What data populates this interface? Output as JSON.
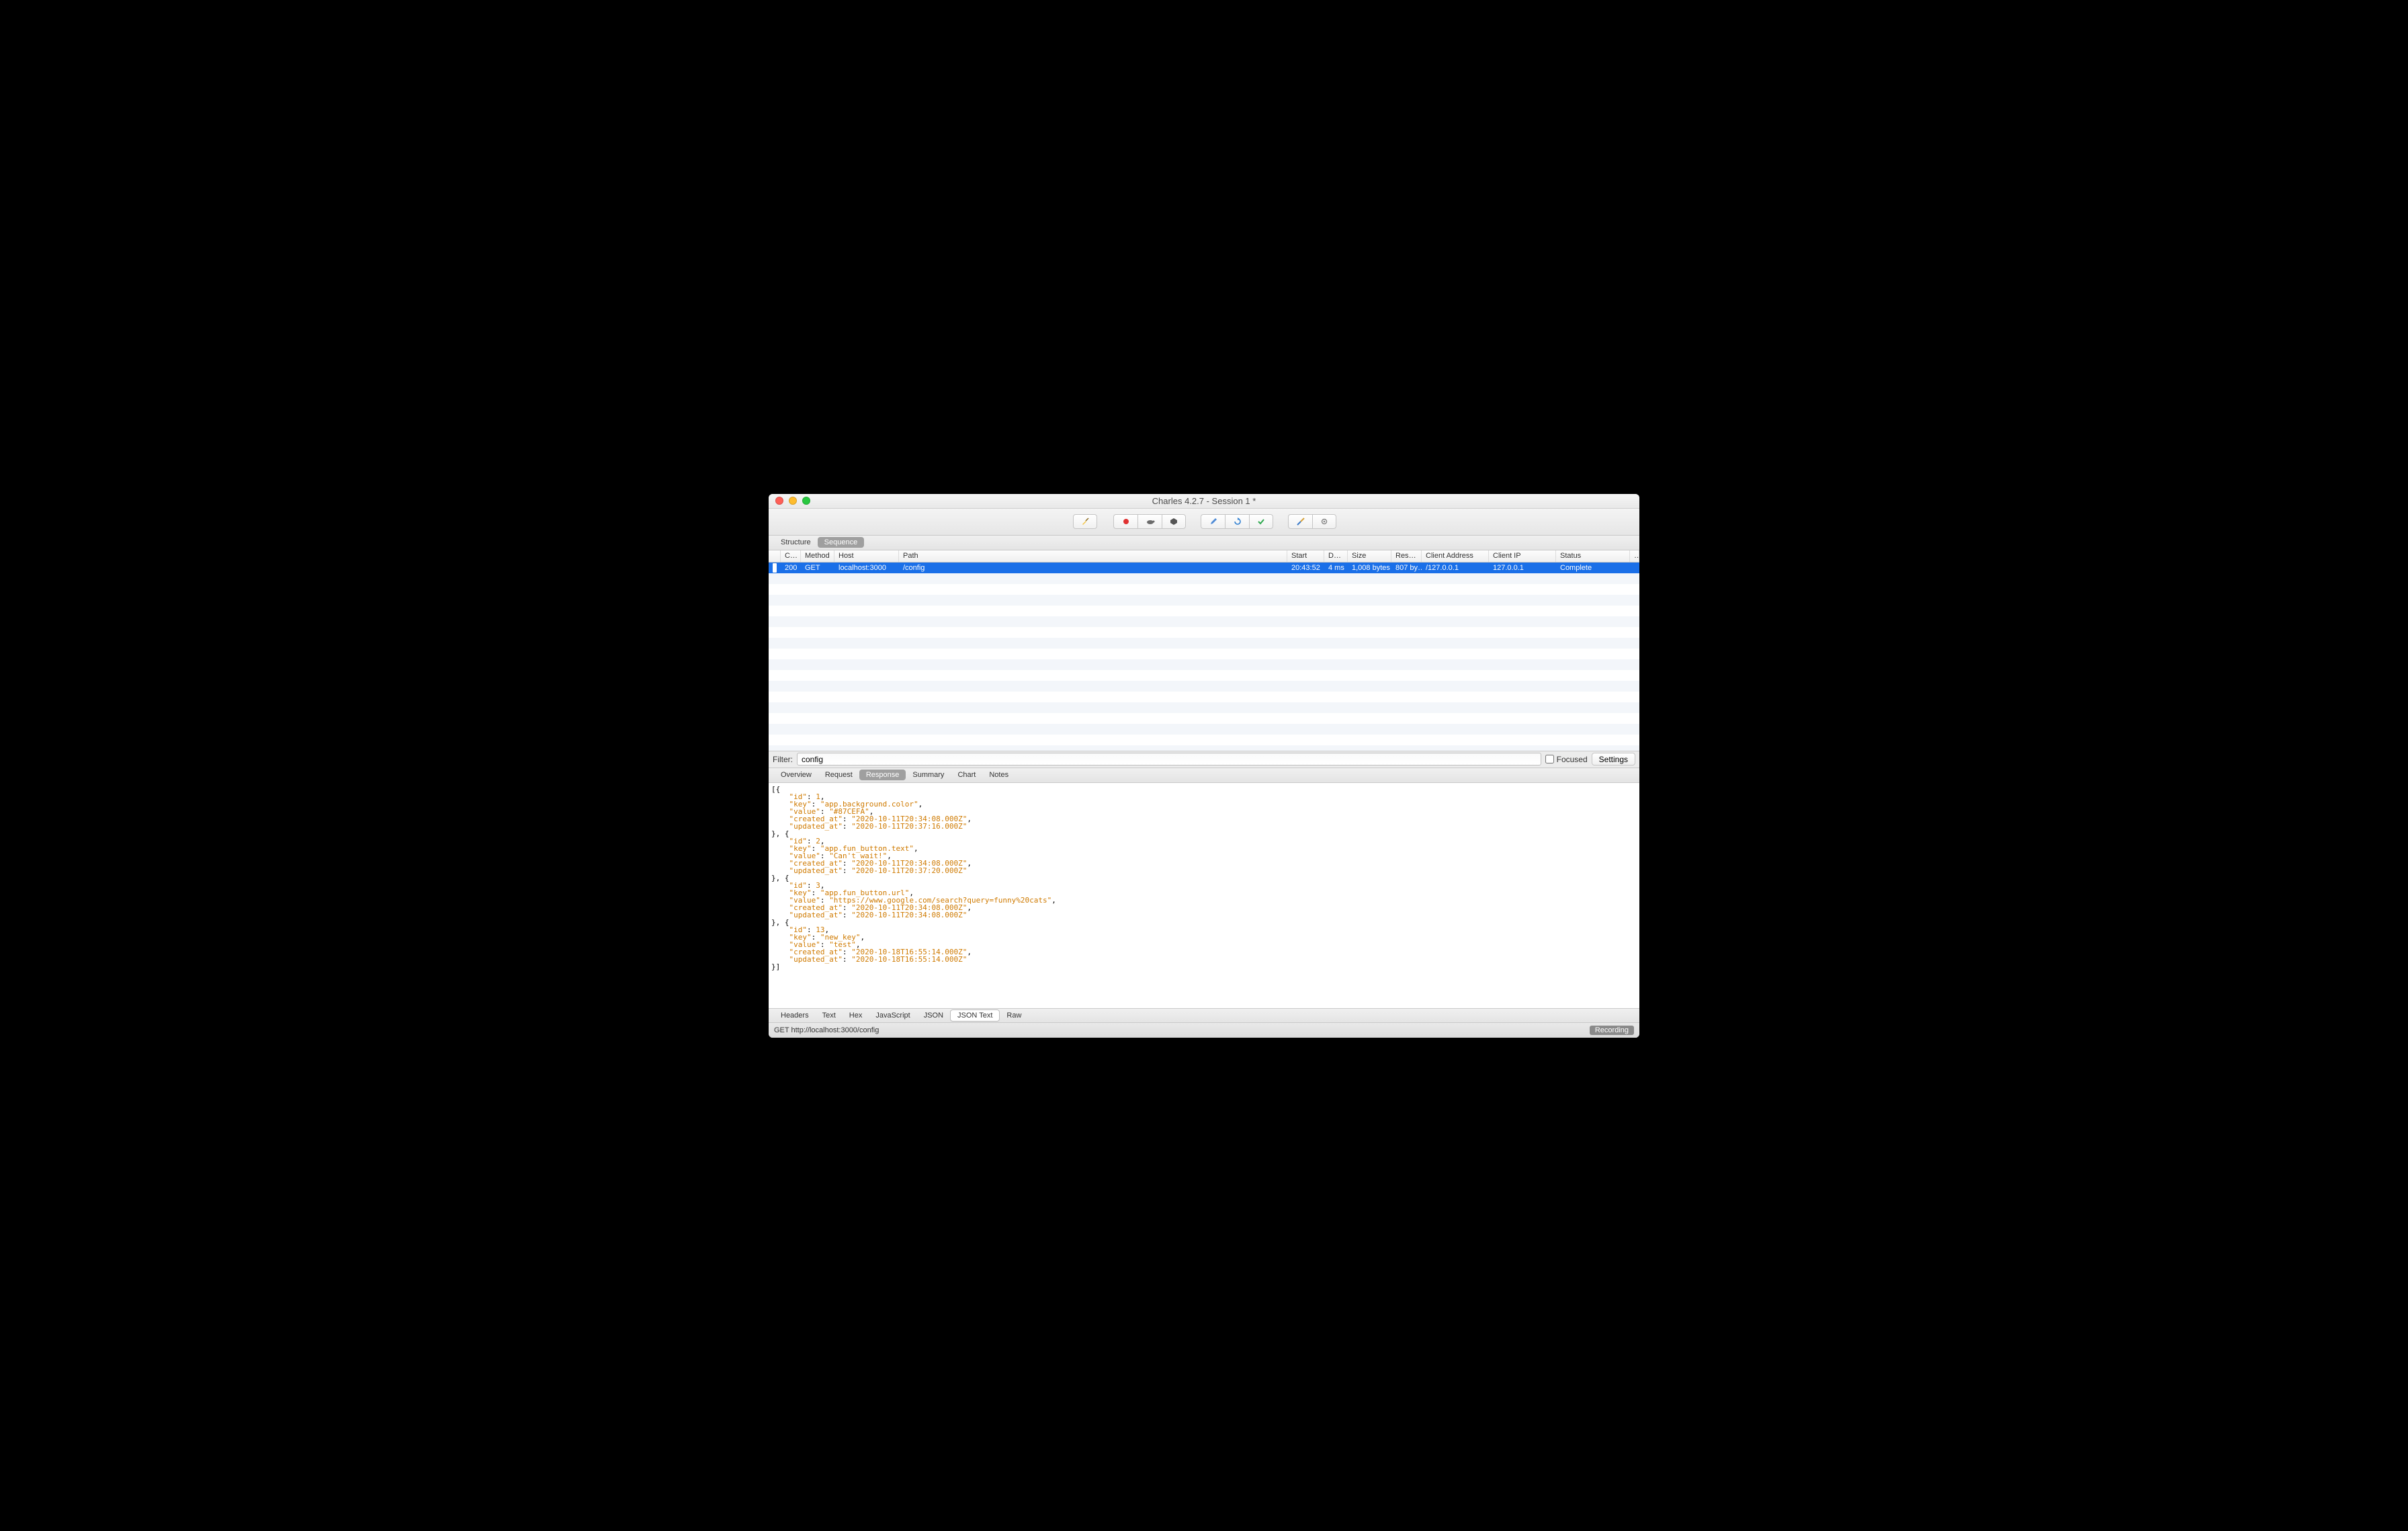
{
  "window": {
    "title": "Charles 4.2.7 - Session 1 *"
  },
  "toolbar_icons": [
    "broom",
    "record",
    "turtle-dark",
    "turtle-darker",
    "pencil",
    "refresh",
    "check",
    "wrench",
    "gear"
  ],
  "view_tabs": [
    {
      "label": "Structure",
      "active": false
    },
    {
      "label": "Sequence",
      "active": true
    }
  ],
  "columns": {
    "code": "C…",
    "method": "Method",
    "host": "Host",
    "path": "Path",
    "start": "Start",
    "duration": "D…",
    "size": "Size",
    "resp": "Resp …",
    "client_address": "Client Address",
    "client_ip": "Client IP",
    "status": "Status",
    "extra": "…"
  },
  "rows": [
    {
      "code": "200",
      "method": "GET",
      "host": "localhost:3000",
      "path": "/config",
      "start": "20:43:52",
      "duration": "4 ms",
      "size": "1,008 bytes",
      "resp": "807 by…",
      "client_address": "/127.0.0.1",
      "client_ip": "127.0.0.1",
      "status": "Complete",
      "selected": true
    }
  ],
  "filter": {
    "label": "Filter:",
    "value": "config",
    "focused_label": "Focused",
    "settings_label": "Settings"
  },
  "panel_tabs": [
    {
      "label": "Overview",
      "active": false
    },
    {
      "label": "Request",
      "active": false
    },
    {
      "label": "Response",
      "active": true
    },
    {
      "label": "Summary",
      "active": false
    },
    {
      "label": "Chart",
      "active": false
    },
    {
      "label": "Notes",
      "active": false
    }
  ],
  "response_json": [
    {
      "id": 1,
      "key": "app.background.color",
      "value": "#87CEFA",
      "created_at": "2020-10-11T20:34:08.000Z",
      "updated_at": "2020-10-11T20:37:16.000Z"
    },
    {
      "id": 2,
      "key": "app.fun_button.text",
      "value": "Can't wait!",
      "created_at": "2020-10-11T20:34:08.000Z",
      "updated_at": "2020-10-11T20:37:20.000Z"
    },
    {
      "id": 3,
      "key": "app.fun_button.url",
      "value": "https://www.google.com/search?query=funny%20cats",
      "created_at": "2020-10-11T20:34:08.000Z",
      "updated_at": "2020-10-11T20:34:08.000Z"
    },
    {
      "id": 13,
      "key": "new_key",
      "value": "test",
      "created_at": "2020-10-18T16:55:14.000Z",
      "updated_at": "2020-10-18T16:55:14.000Z"
    }
  ],
  "format_tabs": [
    {
      "label": "Headers",
      "active": false
    },
    {
      "label": "Text",
      "active": false
    },
    {
      "label": "Hex",
      "active": false
    },
    {
      "label": "JavaScript",
      "active": false
    },
    {
      "label": "JSON",
      "active": false
    },
    {
      "label": "JSON Text",
      "active": true
    },
    {
      "label": "Raw",
      "active": false
    }
  ],
  "status_bar": {
    "left": "GET http://localhost:3000/config",
    "recording": "Recording"
  }
}
